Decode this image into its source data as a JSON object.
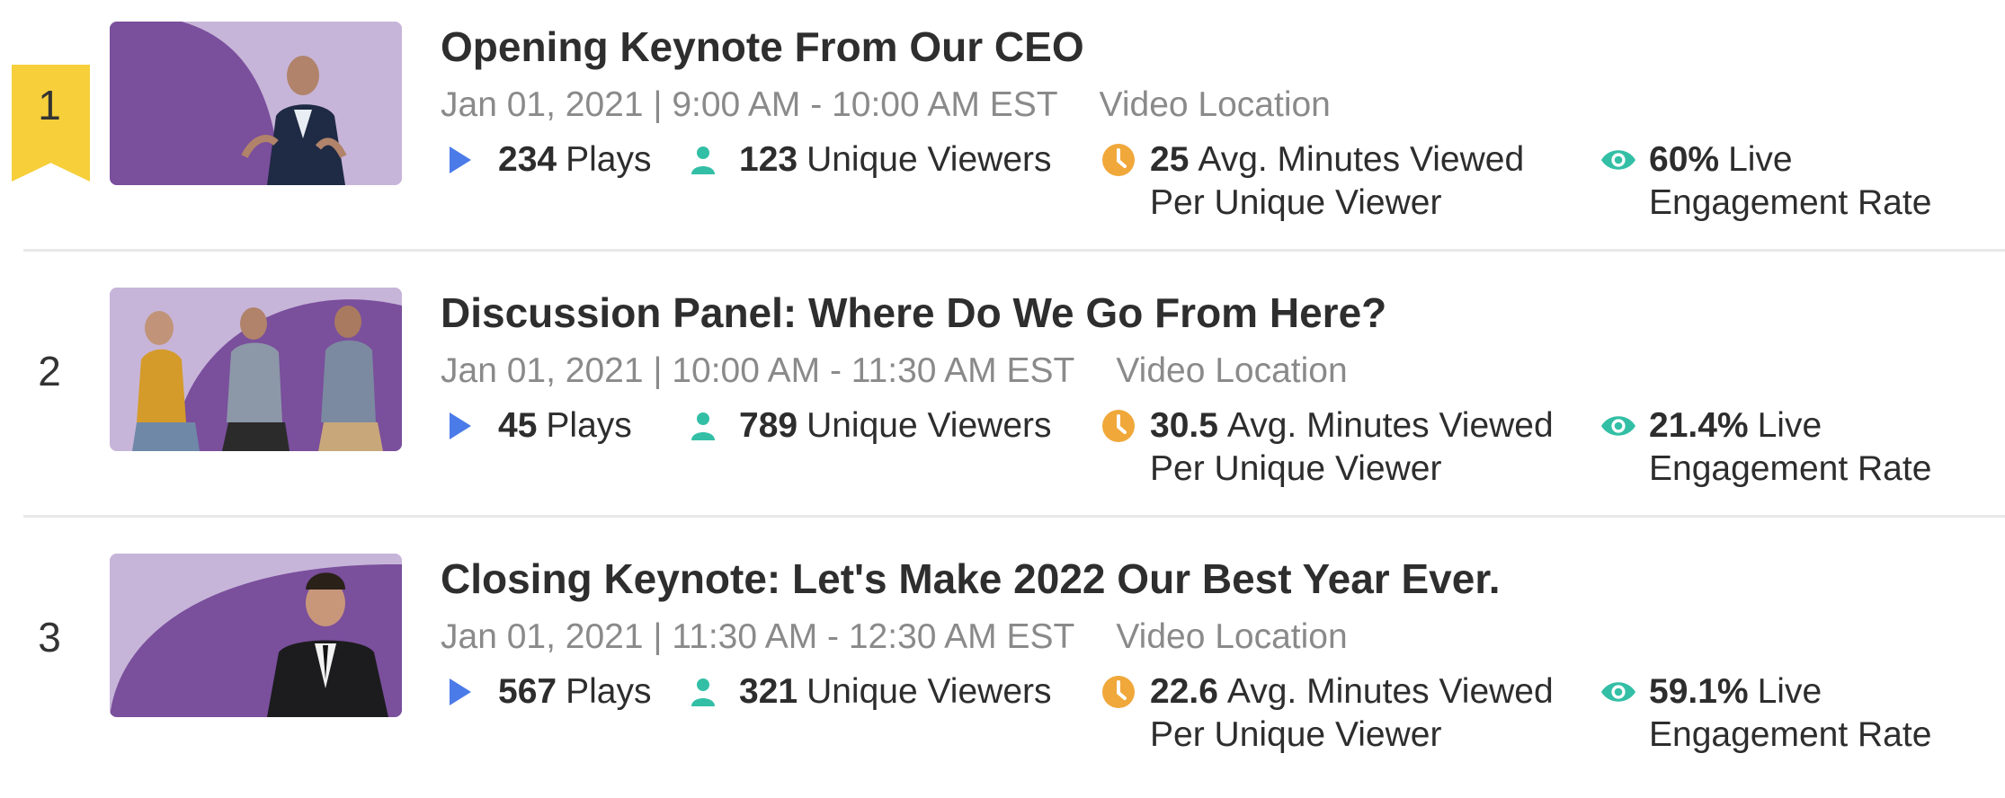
{
  "colors": {
    "ribbon": "#f6cf3a",
    "play": "#4b7be8",
    "viewer": "#33bfa6",
    "clock": "#f0a83a",
    "eye": "#33bfa6",
    "thumbBg": "#c7b5d9",
    "thumbShape": "#7a4f9c"
  },
  "sessions": [
    {
      "rank": "1",
      "title": "Opening Keynote From Our CEO",
      "time": "Jan 01, 2021 | 9:00 AM - 10:00 AM EST",
      "location": "Video Location",
      "plays": "234",
      "plays_label": "Plays",
      "viewers": "123",
      "viewers_label": "Unique Viewers",
      "minutes": "25",
      "minutes_label_1": "Avg. Minutes Viewed",
      "minutes_label_2": "Per Unique Viewer",
      "engagement": "60%",
      "engagement_label_1": "Live",
      "engagement_label_2": "Engagement Rate"
    },
    {
      "rank": "2",
      "title": "Discussion Panel: Where Do We Go From Here?",
      "time": "Jan 01, 2021 | 10:00 AM - 11:30 AM EST",
      "location": "Video Location",
      "plays": "45",
      "plays_label": "Plays",
      "viewers": "789",
      "viewers_label": "Unique Viewers",
      "minutes": "30.5",
      "minutes_label_1": "Avg. Minutes Viewed",
      "minutes_label_2": "Per Unique Viewer",
      "engagement": "21.4%",
      "engagement_label_1": "Live",
      "engagement_label_2": "Engagement Rate"
    },
    {
      "rank": "3",
      "title": "Closing Keynote: Let's Make 2022 Our Best Year Ever.",
      "time": "Jan 01, 2021 | 11:30 AM - 12:30 AM EST",
      "location": "Video Location",
      "plays": "567",
      "plays_label": "Plays",
      "viewers": "321",
      "viewers_label": "Unique Viewers",
      "minutes": "22.6",
      "minutes_label_1": "Avg. Minutes Viewed",
      "minutes_label_2": "Per Unique Viewer",
      "engagement": "59.1%",
      "engagement_label_1": "Live",
      "engagement_label_2": "Engagement Rate"
    }
  ]
}
